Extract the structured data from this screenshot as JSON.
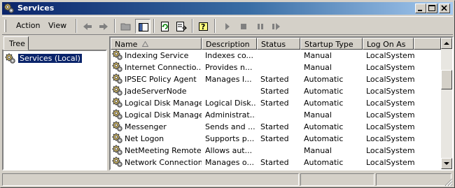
{
  "window": {
    "title": "Services"
  },
  "menu": {
    "action_label": "Action",
    "view_label": "View"
  },
  "tree": {
    "tab_label": "Tree",
    "root_label": "Services (Local)"
  },
  "columns": [
    "Name",
    "Description",
    "Status",
    "Startup Type",
    "Log On As"
  ],
  "rows": [
    {
      "name": "Indexing Service",
      "description": "Indexes co...",
      "status": "",
      "startup": "Manual",
      "logon": "LocalSystem"
    },
    {
      "name": "Internet Connectio...",
      "description": "Provides n...",
      "status": "",
      "startup": "Manual",
      "logon": "LocalSystem"
    },
    {
      "name": "IPSEC Policy Agent",
      "description": "Manages I...",
      "status": "Started",
      "startup": "Automatic",
      "logon": "LocalSystem"
    },
    {
      "name": "JadeServerNode",
      "description": "",
      "status": "Started",
      "startup": "Automatic",
      "logon": "LocalSystem"
    },
    {
      "name": "Logical Disk Manager",
      "description": "Logical Disk...",
      "status": "Started",
      "startup": "Automatic",
      "logon": "LocalSystem"
    },
    {
      "name": "Logical Disk Manage...",
      "description": "Administrat...",
      "status": "",
      "startup": "Manual",
      "logon": "LocalSystem"
    },
    {
      "name": "Messenger",
      "description": "Sends and ...",
      "status": "Started",
      "startup": "Automatic",
      "logon": "LocalSystem"
    },
    {
      "name": "Net Logon",
      "description": "Supports p...",
      "status": "Started",
      "startup": "Automatic",
      "logon": "LocalSystem"
    },
    {
      "name": "NetMeeting Remote...",
      "description": "Allows aut...",
      "status": "",
      "startup": "Manual",
      "logon": "LocalSystem"
    },
    {
      "name": "Network Connections",
      "description": "Manages o...",
      "status": "Started",
      "startup": "Automatic",
      "logon": "LocalSystem"
    }
  ],
  "colors": {
    "titlebar_start": "#0a246a",
    "titlebar_end": "#a6caf0",
    "selection": "#0a246a",
    "face": "#d4d0c8"
  },
  "icons": {
    "window": "services-gear-icon",
    "toolbar": [
      "back-icon",
      "forward-icon",
      "up-folder-icon",
      "show-hide-tree-icon",
      "refresh-icon",
      "export-list-icon",
      "help-icon",
      "start-service-icon",
      "stop-service-icon",
      "pause-service-icon",
      "restart-service-icon"
    ]
  }
}
